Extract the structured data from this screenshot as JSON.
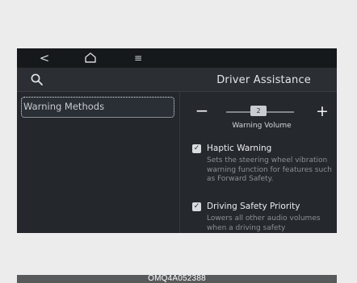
{
  "topbar": {
    "back_glyph": "<",
    "home_icon": "home-icon",
    "menu_glyph": "≡"
  },
  "header": {
    "search_icon": "search-icon",
    "title": "Driver Assistance"
  },
  "sidebar": {
    "items": [
      {
        "label": "Warning Methods",
        "selected": true
      }
    ]
  },
  "volume": {
    "minus_label": "−",
    "plus_label": "+",
    "value": "2",
    "label": "Warning Volume"
  },
  "options": [
    {
      "title": "Haptic Warning",
      "checked": true,
      "description": "Sets the steering wheel vibration warning function for features such as Forward Safety."
    },
    {
      "title": "Driving Safety Priority",
      "checked": true,
      "description": "Lowers all other audio volumes when a driving safety"
    }
  ],
  "caption": "OMQ4A052388",
  "colors": {
    "screen_bg": "#25292e",
    "topbar_bg": "#16191c",
    "text_primary": "#e4e6e8",
    "text_muted": "#8a9096",
    "caption_bg": "#58595b"
  }
}
